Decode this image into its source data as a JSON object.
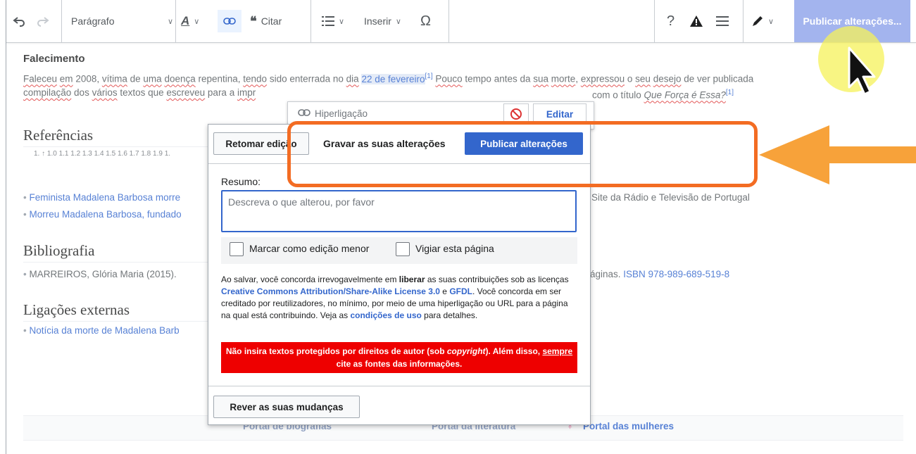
{
  "toolbar": {
    "undo_icon": "undo-icon",
    "redo_icon": "redo-icon",
    "format_label": "Parágrafo",
    "style_icon": "text-style-icon",
    "link_icon": "link-icon",
    "cite_label": "Citar",
    "list_icon": "list-icon",
    "insert_label": "Inserir",
    "special_char_icon": "omega-icon",
    "help_icon": "help-icon",
    "notice_icon": "warning-icon",
    "menu_icon": "hamburger-icon",
    "edit_mode_icon": "pencil-icon",
    "publish_label": "Publicar alterações..."
  },
  "article": {
    "section_falecimento": "Falecimento",
    "p1_a": "Faleceu",
    "p1_b": " ",
    "p1_c": "em",
    "p1_d": " 2008, ",
    "p1_e": "vítima",
    "p1_f": " de ",
    "p1_g": "uma",
    "p1_h": " ",
    "p1_i": "doença",
    "p1_j": " repentina, ",
    "p1_k": "tendo",
    "p1_l": " sido enterrada no ",
    "p1_m": "dia",
    "p1_n": " ",
    "p1_date": "22 de fevereiro",
    "p1_ref": "[1]",
    "p1_o": " ",
    "p1_p": "Pouco",
    "p1_q": " tempo antes da ",
    "p1_r": "sua",
    "p1_s": " ",
    "p1_t": "morte",
    "p1_u": ", ",
    "p1_v": "expressou",
    "p1_w": " o ",
    "p1_x": "seu",
    "p1_y": " ",
    "p1_z": "desejo",
    "p1_end": " de ver publicada",
    "p2_a": "compilação",
    "p2_b": " dos ",
    "p2_c": "vários",
    "p2_d": " textos que ",
    "p2_e": "escreveu",
    "p2_f": " para a ",
    "p2_g": "impr",
    "p2_h": "com o título ",
    "p2_title": "Que Força é Essa?",
    "p2_ref": "[1]",
    "h_referencias": "Referências",
    "ref_line": "1. ↑ 1.0 1.1 1.2 1.3 1.4 1.5 1.6 1.7 1.8 1.9 1.",
    "ext1_link": "Feminista Madalena Barbosa morre",
    "ext1_tail": "Site da Rádio e Televisão de Portugal",
    "ext2_link": "Morreu Madalena Barbosa, fundado",
    "h_bibliografia": "Bibliografia",
    "biblio_text": "MARREIROS, Glória Maria (2015).",
    "biblio_tail": "áginas. ",
    "biblio_isbn": "ISBN 978-989-689-519-8",
    "h_ligacoes": "Ligações externas",
    "noticia_link": "Notícia da morte de Madalena Barb",
    "portal1": "Portal de biografias",
    "portal2": "Portal da literatura",
    "portal3": "Portal das mulheres"
  },
  "link_popup": {
    "label": "Hiperligação",
    "edit_label": "Editar"
  },
  "save_dialog": {
    "resume_button": "Retomar edição",
    "title": "Gravar as suas alterações",
    "publish_button": "Publicar alterações",
    "summary_label": "Resumo:",
    "summary_placeholder": "Descreva o que alterou, por favor",
    "minor_edit_label": "Marcar como edição menor",
    "watch_label": "Vigiar esta página",
    "legal_1": "Ao salvar, você concorda irrevogavelmente em ",
    "legal_liberar": "liberar",
    "legal_2": " as suas contribuições sob as licenças ",
    "legal_cc": "Creative Commons Attribution/Share-Alike License 3.0",
    "legal_e": " e ",
    "legal_gfdl": "GFDL",
    "legal_3": ". Você concorda em ser creditado por reutilizadores, no mínimo, por meio de uma hiperligação ou URL para a página na qual está contribuindo. Veja as ",
    "legal_terms": "condições de uso",
    "legal_4": " para detalhes.",
    "warning_1": "Não insira textos protegidos por direitos de autor (sob ",
    "warning_copyright": "copyright",
    "warning_2": "). Além disso, ",
    "warning_sempre": "sempre",
    "warning_3": " cite as fontes das informações.",
    "review_button": "Rever as suas mudanças"
  },
  "colors": {
    "accent": "#3366cc",
    "annotation": "#f36c23",
    "warning_bg": "#ee0000",
    "cursor_highlight": "#f5f25a"
  }
}
